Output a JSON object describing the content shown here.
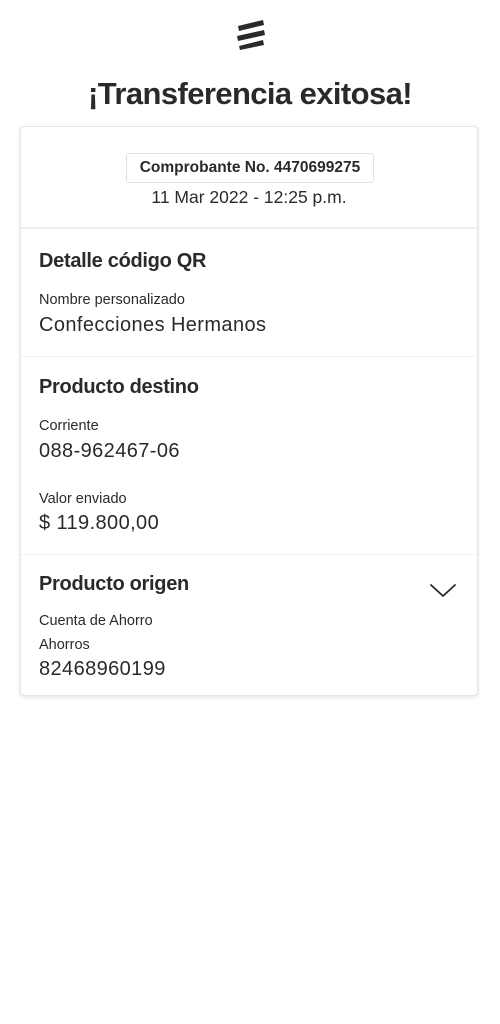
{
  "header": {
    "logo_icon": "bank-logo-icon",
    "title": "¡Transferencia exitosa!"
  },
  "receipt": {
    "number_label": "Comprobante No. 4470699275",
    "datetime": "11 Mar 2022 - 12:25 p.m."
  },
  "qr_detail": {
    "title": "Detalle código QR",
    "name_label": "Nombre personalizado",
    "name_value": "Confecciones Hermanos"
  },
  "destination": {
    "title": "Producto destino",
    "account_type": "Corriente",
    "account_number": "088-962467-06",
    "amount_label": "Valor enviado",
    "amount_value": "$ 119.800,00"
  },
  "origin": {
    "title": "Producto origen",
    "expand_icon": "chevron-down-icon",
    "account_type": "Cuenta de Ahorro",
    "account_subtype": "Ahorros",
    "account_number": "82468960199"
  }
}
